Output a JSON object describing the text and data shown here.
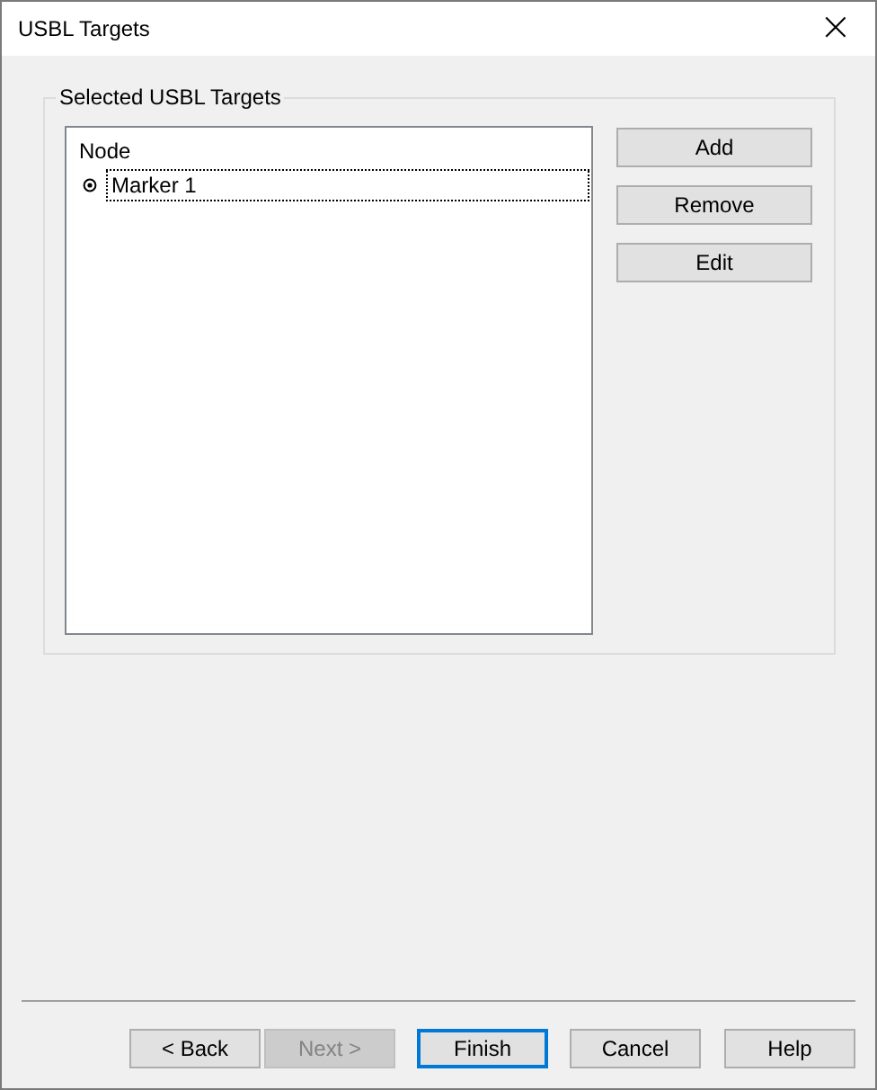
{
  "window": {
    "title": "USBL Targets",
    "close": "×"
  },
  "group": {
    "title": "Selected USBL Targets",
    "list": {
      "column": "Node",
      "items": [
        {
          "label": "Marker 1",
          "selected": true
        }
      ]
    },
    "buttons": [
      {
        "label": "Add"
      },
      {
        "label": "Remove"
      },
      {
        "label": "Edit"
      }
    ]
  },
  "footer_buttons": [
    {
      "label": "< Back",
      "disabled": false,
      "default": false
    },
    {
      "label": "Next >",
      "disabled": true,
      "default": false
    },
    {
      "label": "Finish",
      "disabled": false,
      "default": true
    },
    {
      "label": "Cancel",
      "disabled": false,
      "default": false
    },
    {
      "label": "Help",
      "disabled": false,
      "default": false
    }
  ]
}
